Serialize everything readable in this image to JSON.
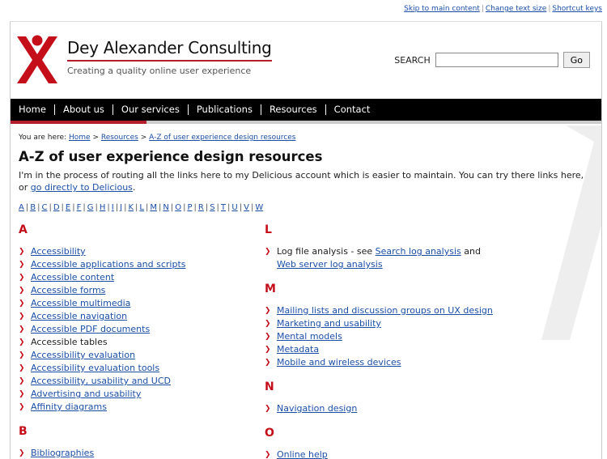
{
  "top_links": [
    "Skip to main content",
    "Change text size",
    "Shortcut keys"
  ],
  "brand": {
    "title": "Dey Alexander Consulting",
    "tagline": "Creating a quality online user experience"
  },
  "search": {
    "label": "SEARCH",
    "button": "Go",
    "value": ""
  },
  "nav": [
    "Home",
    "About us",
    "Our services",
    "Publications",
    "Resources",
    "Contact"
  ],
  "breadcrumb": {
    "prefix": "You are here:",
    "home": "Home",
    "resources": "Resources",
    "current": "A-Z of user experience design resources",
    "sep": ">"
  },
  "page": {
    "title": "A-Z of user experience design resources",
    "intro_text": "I'm in the process of routing all the links here to my Delicious account which is easier to maintain. You can try there links here, or",
    "intro_link": "go directly to Delicious",
    "intro_end": "."
  },
  "letters": [
    "A",
    "B",
    "C",
    "D",
    "E",
    "F",
    "G",
    "H",
    "I",
    "J",
    "K",
    "L",
    "M",
    "N",
    "O",
    "P",
    "R",
    "S",
    "T",
    "U",
    "V",
    "W"
  ],
  "sections": {
    "A": {
      "head": "A",
      "items": [
        "Accessibility",
        "Accessible applications and scripts",
        "Accessible content",
        "Accessible forms",
        "Accessible multimedia",
        "Accessible navigation",
        "Accessible PDF documents",
        "Accessible tables",
        "Accessibility evaluation",
        "Accessibility evaluation tools",
        "Accessibility, usability and UCD",
        "Advertising and usability",
        "Affinity diagrams"
      ]
    },
    "B": {
      "head": "B",
      "items": [
        "Bibliographies"
      ]
    },
    "L": {
      "head": "L",
      "text1": "Log file analysis - see",
      "link1": "Search log analysis",
      "text2": "and",
      "link2": "Web server log analysis"
    },
    "M": {
      "head": "M",
      "items": [
        "Mailing lists and discussion groups on UX design",
        "Marketing and usability",
        "Mental models",
        "Metadata",
        "Mobile and wireless devices"
      ]
    },
    "N": {
      "head": "N",
      "items": [
        "Navigation design"
      ]
    },
    "O": {
      "head": "O",
      "items": [
        "Online help"
      ]
    }
  },
  "colors": {
    "accent": "#b41e2c",
    "link": "#1a4fa8",
    "nav_bg": "#000000"
  }
}
